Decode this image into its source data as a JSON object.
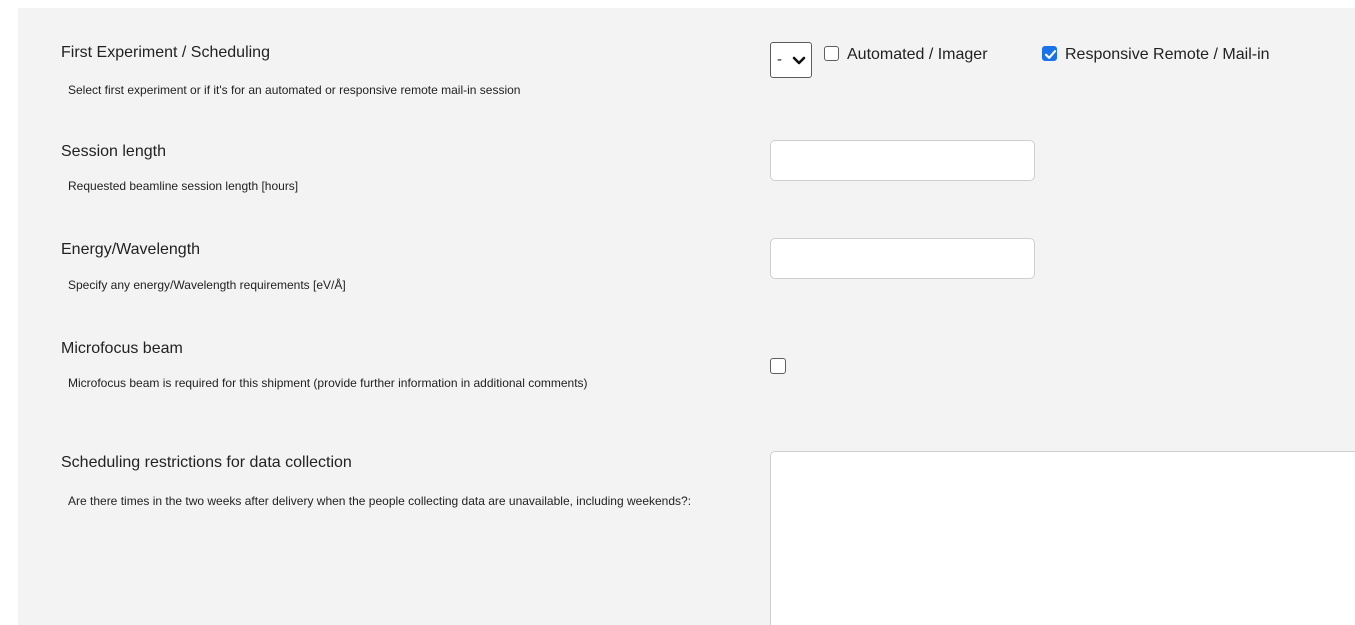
{
  "fields": {
    "first_experiment": {
      "label": "First Experiment / Scheduling",
      "description": "Select first experiment or if it's for an automated or responsive remote mail-in session",
      "select_value": "-",
      "automated_label": "Automated / Imager",
      "automated_checked": false,
      "responsive_label": "Responsive Remote / Mail-in",
      "responsive_checked": true
    },
    "session_length": {
      "label": "Session length",
      "description": "Requested beamline session length [hours]",
      "value": ""
    },
    "energy": {
      "label": "Energy/Wavelength",
      "description": "Specify any energy/Wavelength requirements [eV/Å]",
      "value": ""
    },
    "microfocus": {
      "label": "Microfocus beam",
      "description": "Microfocus beam is required for this shipment (provide further information in additional comments)",
      "checked": false
    },
    "scheduling_restrictions": {
      "label": "Scheduling restrictions for data collection",
      "description": "Are there times in the two weeks after delivery when the people collecting data are unavailable, including weekends?:",
      "value": ""
    }
  },
  "colors": {
    "panel_bg": "#f3f3f3",
    "checkbox_accent": "#1a73e8"
  }
}
